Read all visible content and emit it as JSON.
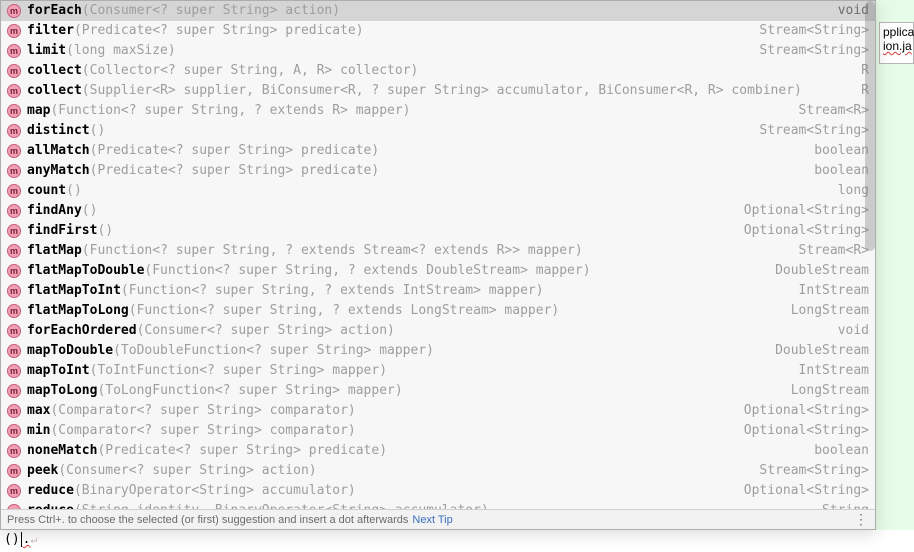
{
  "background": {
    "tab_text_1": "pplicat",
    "tab_text_2": "ion.ja"
  },
  "suggestions": [
    {
      "name": "forEach",
      "params": "(Consumer<? super String> action)",
      "return": "void",
      "selected": true
    },
    {
      "name": "filter",
      "params": "(Predicate<? super String> predicate)",
      "return": "Stream<String>"
    },
    {
      "name": "limit",
      "params": "(long maxSize)",
      "return": "Stream<String>"
    },
    {
      "name": "collect",
      "params": "(Collector<? super String, A, R> collector)",
      "return": "R"
    },
    {
      "name": "collect",
      "params": "(Supplier<R> supplier, BiConsumer<R, ? super String> accumulator, BiConsumer<R, R> combiner)",
      "return": "R"
    },
    {
      "name": "map",
      "params": "(Function<? super String, ? extends R> mapper)",
      "return": "Stream<R>"
    },
    {
      "name": "distinct",
      "params": "()",
      "return": "Stream<String>"
    },
    {
      "name": "allMatch",
      "params": "(Predicate<? super String> predicate)",
      "return": "boolean"
    },
    {
      "name": "anyMatch",
      "params": "(Predicate<? super String> predicate)",
      "return": "boolean"
    },
    {
      "name": "count",
      "params": "()",
      "return": "long"
    },
    {
      "name": "findAny",
      "params": "()",
      "return": "Optional<String>"
    },
    {
      "name": "findFirst",
      "params": "()",
      "return": "Optional<String>"
    },
    {
      "name": "flatMap",
      "params": "(Function<? super String, ? extends Stream<? extends R>> mapper)",
      "return": "Stream<R>"
    },
    {
      "name": "flatMapToDouble",
      "params": "(Function<? super String, ? extends DoubleStream> mapper)",
      "return": "DoubleStream"
    },
    {
      "name": "flatMapToInt",
      "params": "(Function<? super String, ? extends IntStream> mapper)",
      "return": "IntStream"
    },
    {
      "name": "flatMapToLong",
      "params": "(Function<? super String, ? extends LongStream> mapper)",
      "return": "LongStream"
    },
    {
      "name": "forEachOrdered",
      "params": "(Consumer<? super String> action)",
      "return": "void"
    },
    {
      "name": "mapToDouble",
      "params": "(ToDoubleFunction<? super String> mapper)",
      "return": "DoubleStream"
    },
    {
      "name": "mapToInt",
      "params": "(ToIntFunction<? super String> mapper)",
      "return": "IntStream"
    },
    {
      "name": "mapToLong",
      "params": "(ToLongFunction<? super String> mapper)",
      "return": "LongStream"
    },
    {
      "name": "max",
      "params": "(Comparator<? super String> comparator)",
      "return": "Optional<String>"
    },
    {
      "name": "min",
      "params": "(Comparator<? super String> comparator)",
      "return": "Optional<String>"
    },
    {
      "name": "noneMatch",
      "params": "(Predicate<? super String> predicate)",
      "return": "boolean"
    },
    {
      "name": "peek",
      "params": "(Consumer<? super String> action)",
      "return": "Stream<String>"
    },
    {
      "name": "reduce",
      "params": "(BinaryOperator<String> accumulator)",
      "return": "Optional<String>"
    },
    {
      "name": "reduce",
      "params": "(String identity, BinaryOperator<String> accumulator)",
      "return": "String"
    }
  ],
  "hint": {
    "text": "Press Ctrl+. to choose the selected (or first) suggestion and insert a dot afterwards",
    "link": "Next Tip",
    "dots": "⋮"
  },
  "editor": {
    "prefix": "()",
    "after": ".",
    "eol": "↵"
  },
  "icon_glyph": "m"
}
